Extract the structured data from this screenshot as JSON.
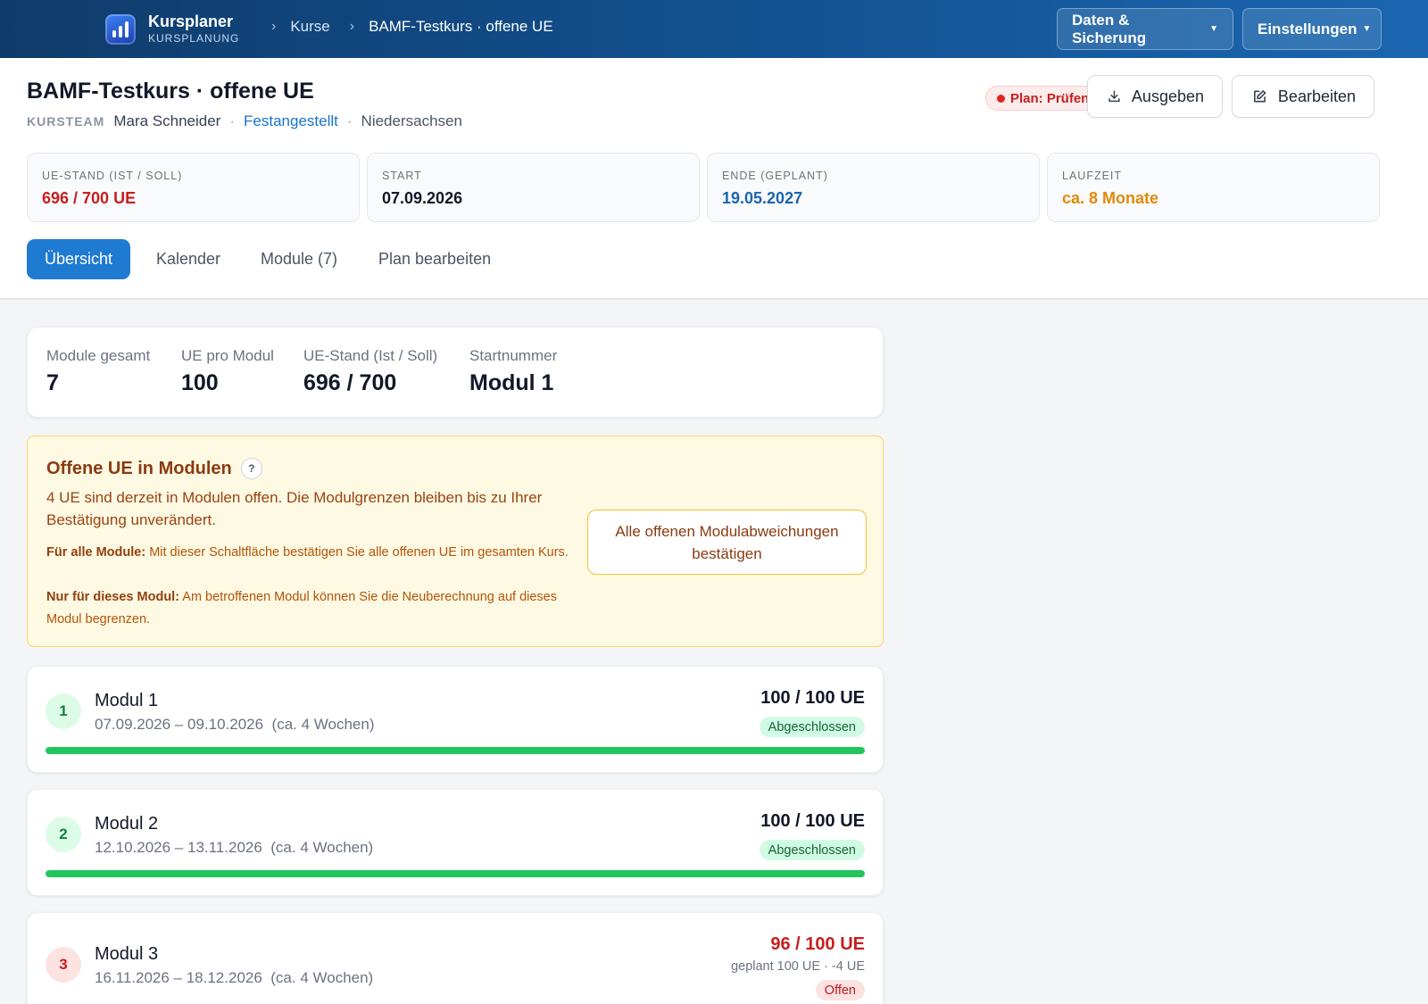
{
  "app": {
    "title": "Kursplaner",
    "subtitle": "KURSPLANUNG"
  },
  "breadcrumb": {
    "items": [
      "Kurse",
      "BAMF-Testkurs · offene UE"
    ]
  },
  "topnav": {
    "data_label": "Daten & Sicherung",
    "settings_label": "Einstellungen"
  },
  "course": {
    "title": "BAMF-Testkurs · offene UE",
    "team_label": "KURSTEAM",
    "teacher": "Mara Schneider",
    "employment": "Festangestellt",
    "region": "Niedersachsen",
    "status": "Plan: Prüfen",
    "export_label": "Ausgeben",
    "edit_label": "Bearbeiten"
  },
  "stats": [
    {
      "label": "UE-STAND (IST / SOLL)",
      "value": "696 / 700 UE",
      "color": "#c81e1e"
    },
    {
      "label": "START",
      "value": "07.09.2026",
      "color": "#111827"
    },
    {
      "label": "ENDE (GEPLANT)",
      "value": "19.05.2027",
      "color": "#1a66b0"
    },
    {
      "label": "LAUFZEIT",
      "value": "ca. 8 Monate",
      "color": "#e08a0b"
    }
  ],
  "tabs": [
    "Übersicht",
    "Kalender",
    "Module (7)",
    "Plan bearbeiten"
  ],
  "summary": [
    {
      "label": "Module gesamt",
      "value": "7"
    },
    {
      "label": "UE pro Modul",
      "value": "100"
    },
    {
      "label": "UE-Stand (Ist / Soll)",
      "value": "696 / 700"
    },
    {
      "label": "Startnummer",
      "value": "Modul 1"
    }
  ],
  "warning": {
    "title": "Offene UE in Modulen",
    "help": "?",
    "text": "4 UE sind derzeit in Modulen offen. Die Modulgrenzen bleiben bis zu Ihrer Bestätigung unverändert.",
    "note1_bold": "Für alle Module:",
    "note1_text": " Mit dieser Schaltfläche bestätigen Sie alle offenen UE im gesamten Kurs.",
    "note2_bold": "Nur für dieses Modul:",
    "note2_text": " Am betroffenen Modul können Sie die Neuberechnung auf dieses Modul begrenzen.",
    "button": "Alle offenen Modulabweichungen bestätigen"
  },
  "modules": [
    {
      "num": "1",
      "name": "Modul 1",
      "dates": "07.09.2026 – 09.10.2026",
      "duration": "(ca. 4 Wochen)",
      "ue": "100 / 100 UE",
      "status": "Abgeschlossen",
      "progress": 1.0
    },
    {
      "num": "2",
      "name": "Modul 2",
      "dates": "12.10.2026 – 13.11.2026",
      "duration": "(ca. 4 Wochen)",
      "ue": "100 / 100 UE",
      "status": "Abgeschlossen",
      "progress": 1.0
    },
    {
      "num": "3",
      "name": "Modul 3",
      "dates": "16.11.2026 – 18.12.2026",
      "duration": "(ca. 4 Wochen)",
      "ue": "96 / 100 UE",
      "planned": "geplant 100 UE · -4 UE",
      "status": "Offen"
    }
  ]
}
